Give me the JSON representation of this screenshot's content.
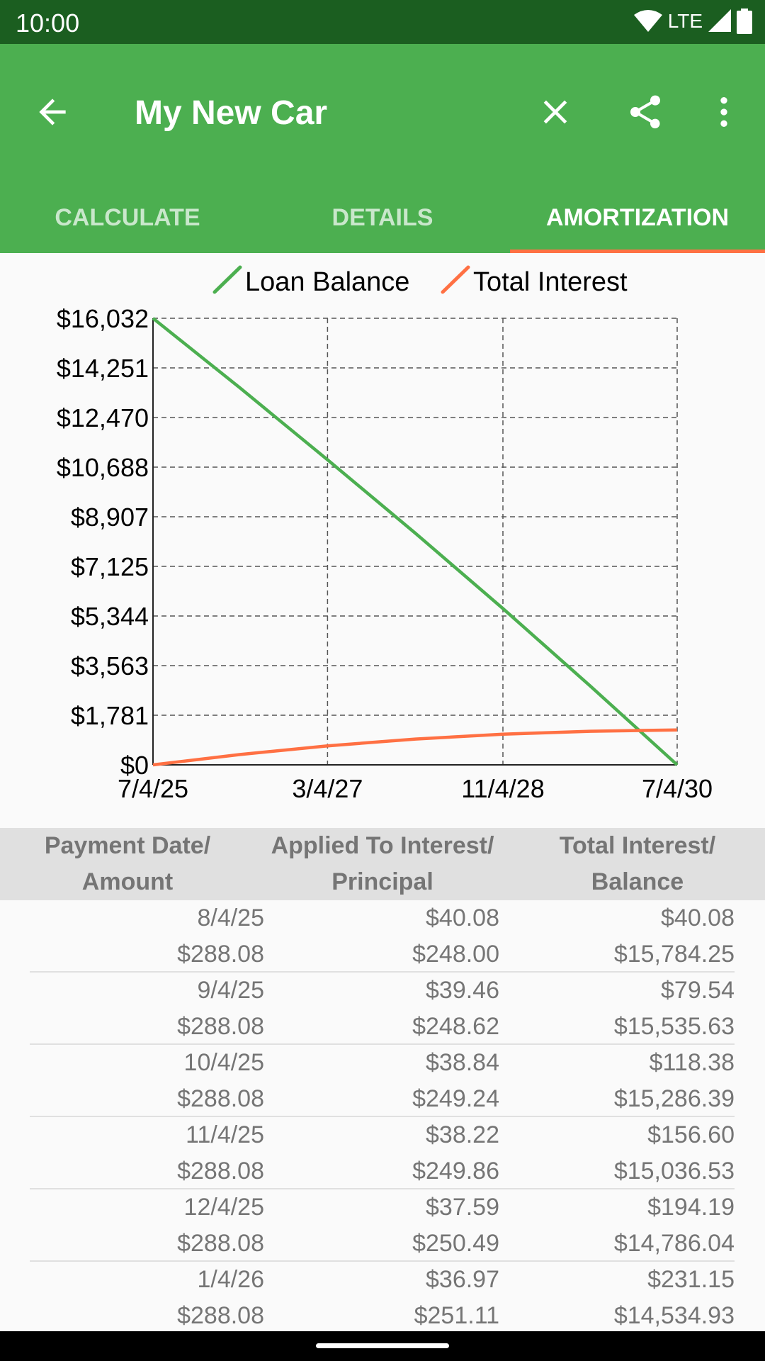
{
  "status_bar": {
    "time": "10:00",
    "network": "LTE"
  },
  "app_bar": {
    "title": "My New Car",
    "icons": [
      "back-arrow-icon",
      "close-icon",
      "share-icon",
      "more-vert-icon"
    ],
    "color": "#4caf50"
  },
  "tabs": [
    {
      "label": "CALCULATE"
    },
    {
      "label": "DETAILS"
    },
    {
      "label": "AMORTIZATION",
      "active": true
    }
  ],
  "chart_data": {
    "type": "line",
    "legend": [
      "Loan Balance",
      "Total Interest"
    ],
    "legend_placement": "top",
    "grid": true,
    "y_ticks": [
      "$0",
      "$1,781",
      "$3,563",
      "$5,344",
      "$7,125",
      "$8,907",
      "$10,688",
      "$12,470",
      "$14,251",
      "$16,032"
    ],
    "x_ticks": [
      "7/4/25",
      "3/4/27",
      "11/4/28",
      "7/4/30"
    ],
    "ylim": [
      0,
      16032
    ],
    "x": [
      "7/4/25",
      "5/4/26",
      "3/4/27",
      "1/4/28",
      "11/4/28",
      "9/4/29",
      "7/4/30"
    ],
    "series": [
      {
        "name": "Loan Balance",
        "color": "#4caf50",
        "values": [
          16032,
          13524,
          10952,
          8316,
          5611,
          2834,
          0
        ]
      },
      {
        "name": "Total Interest",
        "color": "#ff7043",
        "values": [
          0,
          373,
          682,
          926,
          1102,
          1206,
          1253
        ]
      }
    ]
  },
  "table": {
    "headers": [
      [
        "Payment Date/",
        "Amount"
      ],
      [
        "Applied To Interest/",
        "Principal"
      ],
      [
        "Total Interest/",
        "Balance"
      ]
    ],
    "rows": [
      [
        [
          "8/4/25",
          "$288.08"
        ],
        [
          "$40.08",
          "$248.00"
        ],
        [
          "$40.08",
          "$15,784.25"
        ]
      ],
      [
        [
          "9/4/25",
          "$288.08"
        ],
        [
          "$39.46",
          "$248.62"
        ],
        [
          "$79.54",
          "$15,535.63"
        ]
      ],
      [
        [
          "10/4/25",
          "$288.08"
        ],
        [
          "$38.84",
          "$249.24"
        ],
        [
          "$118.38",
          "$15,286.39"
        ]
      ],
      [
        [
          "11/4/25",
          "$288.08"
        ],
        [
          "$38.22",
          "$249.86"
        ],
        [
          "$156.60",
          "$15,036.53"
        ]
      ],
      [
        [
          "12/4/25",
          "$288.08"
        ],
        [
          "$37.59",
          "$250.49"
        ],
        [
          "$194.19",
          "$14,786.04"
        ]
      ],
      [
        [
          "1/4/26",
          "$288.08"
        ],
        [
          "$36.97",
          "$251.11"
        ],
        [
          "$231.15",
          "$14,534.93"
        ]
      ]
    ]
  }
}
